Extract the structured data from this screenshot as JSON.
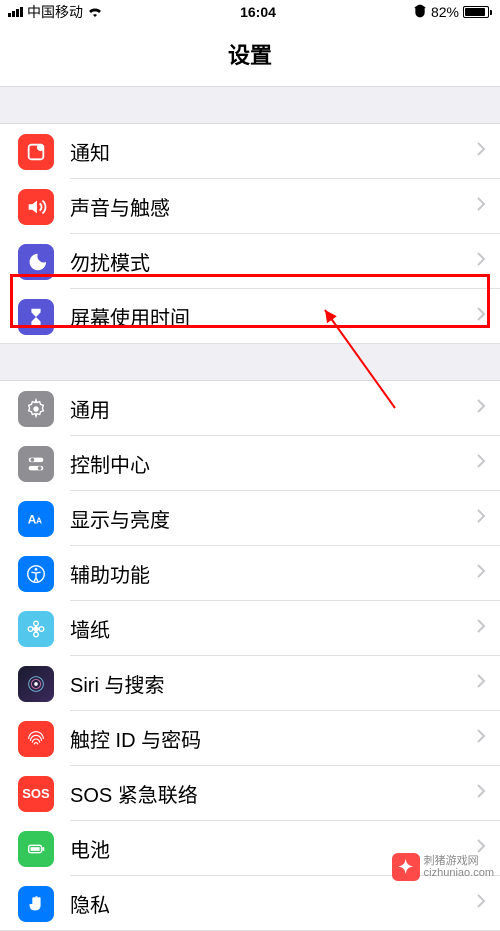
{
  "status": {
    "carrier": "中国移动",
    "time": "16:04",
    "battery_pct": "82%"
  },
  "title": "设置",
  "section1": [
    {
      "id": "notifications",
      "label": "通知"
    },
    {
      "id": "sounds",
      "label": "声音与触感"
    },
    {
      "id": "dnd",
      "label": "勿扰模式"
    },
    {
      "id": "screentime",
      "label": "屏幕使用时间"
    }
  ],
  "section2": [
    {
      "id": "general",
      "label": "通用"
    },
    {
      "id": "control",
      "label": "控制中心"
    },
    {
      "id": "display",
      "label": "显示与亮度"
    },
    {
      "id": "accessibility",
      "label": "辅助功能"
    },
    {
      "id": "wallpaper",
      "label": "墙纸"
    },
    {
      "id": "siri",
      "label": "Siri 与搜索"
    },
    {
      "id": "touchid",
      "label": "触控 ID 与密码"
    },
    {
      "id": "sos",
      "label": "SOS 紧急联络",
      "icon_text": "SOS"
    },
    {
      "id": "battery",
      "label": "电池"
    },
    {
      "id": "privacy",
      "label": "隐私"
    }
  ],
  "watermark": {
    "line1": "刺猪游戏网",
    "line2": "cizhuniao.com"
  }
}
